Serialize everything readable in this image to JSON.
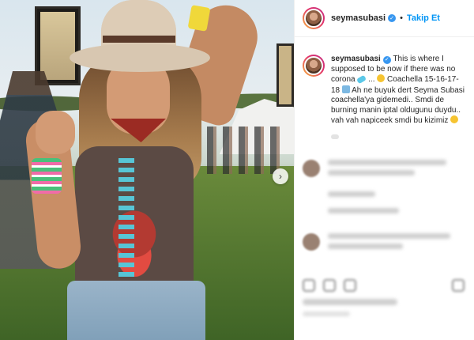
{
  "header": {
    "username": "seymasubasi",
    "follow_label": "Takip Et",
    "separator": "•"
  },
  "caption": {
    "username": "seymasubasi",
    "line1": "This is where I",
    "line2": "supposed to be now if there was no",
    "line3_a": "corona",
    "line3_b": "...",
    "line3_c": "Coachella 15-16-17-",
    "line4_a": "18",
    "line4_b": "Ah ne buyuk dert Seyma Subasi",
    "line5": "coachella'ya gidemedi.. Smdi de",
    "line6": "burning manin iptal oldugunu duydu..",
    "line7": "vah vah napiceek smdi bu kizimiz"
  },
  "icons": {
    "verified": "verified-badge-icon",
    "next": "chevron-right-icon",
    "like": "heart-icon",
    "comment": "comment-icon",
    "share": "share-icon",
    "save": "bookmark-icon"
  },
  "colors": {
    "follow_blue": "#0095f6",
    "verified_blue": "#3897f0"
  }
}
